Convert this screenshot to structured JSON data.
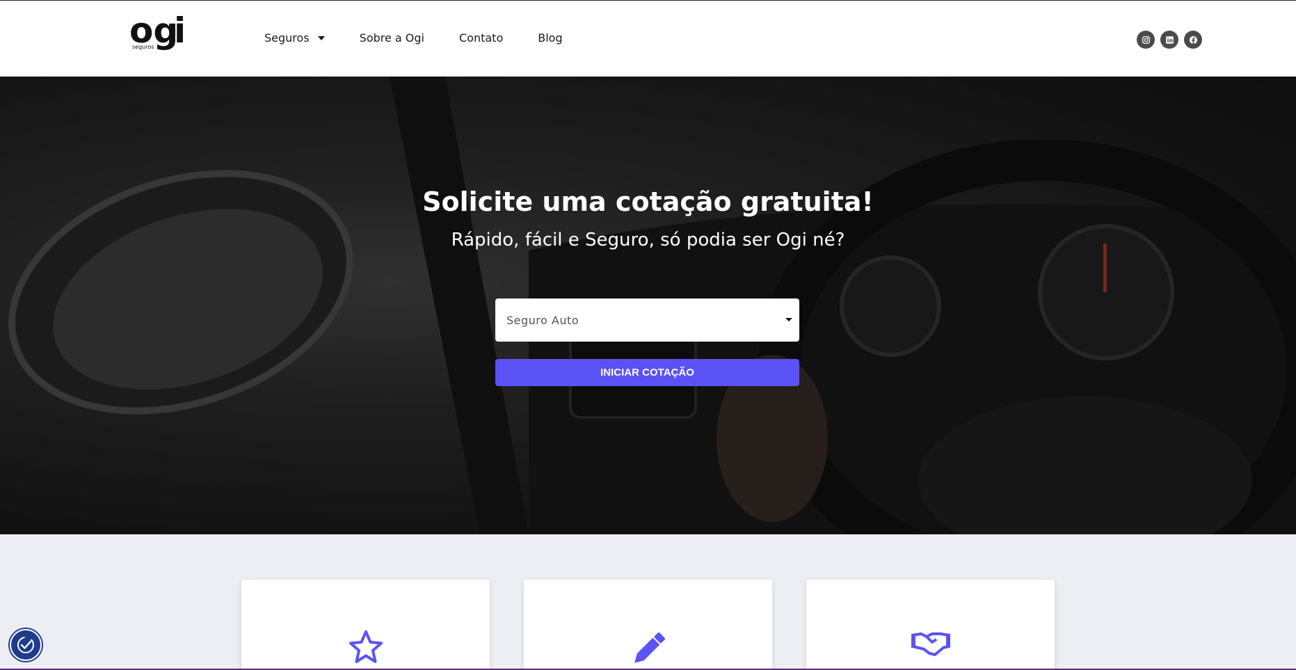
{
  "brand": {
    "name": "Ogi",
    "tagline": "seguros",
    "accent_color": "#5b52f6"
  },
  "nav": {
    "items": [
      {
        "label": "Seguros",
        "has_dropdown": true
      },
      {
        "label": "Sobre a Ogi"
      },
      {
        "label": "Contato"
      },
      {
        "label": "Blog"
      }
    ]
  },
  "socials": [
    {
      "icon": "instagram-icon"
    },
    {
      "icon": "linkedin-icon"
    },
    {
      "icon": "facebook-icon"
    }
  ],
  "hero": {
    "title": "Solicite uma cotação gratuita!",
    "subtitle": "Rápido, fácil e Seguro, só podia ser Ogi né?",
    "select_value": "Seguro Auto",
    "cta_label": "INICIAR COTAÇÃO"
  },
  "cards": [
    {
      "icon": "star-icon"
    },
    {
      "icon": "pencil-icon"
    },
    {
      "icon": "handshake-icon"
    }
  ],
  "accessibility": {
    "icon": "accessibility-icon"
  }
}
